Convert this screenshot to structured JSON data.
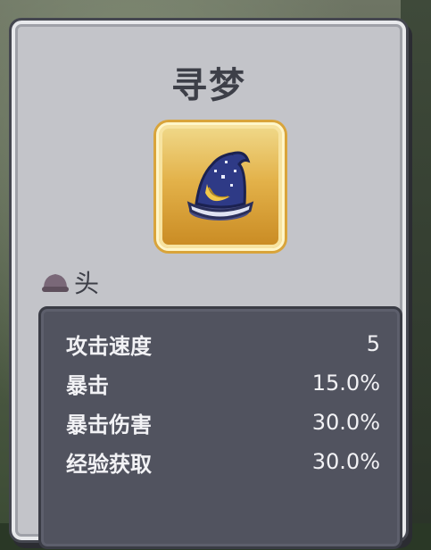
{
  "item": {
    "name": "寻梦",
    "icon": "wizard-hat-icon",
    "slot_icon": "head-slot-icon",
    "slot_label": "头"
  },
  "stats": [
    {
      "label": "攻击速度",
      "value": "5"
    },
    {
      "label": "暴击",
      "value": "15.0%"
    },
    {
      "label": "暴击伤害",
      "value": "30.0%"
    },
    {
      "label": "经验获取",
      "value": "30.0%"
    }
  ],
  "colors": {
    "panel": "#c3c4c9",
    "stats_bg": "#51535f",
    "frame_gold": "#e3b24a",
    "hat_blue": "#2e3a86"
  }
}
